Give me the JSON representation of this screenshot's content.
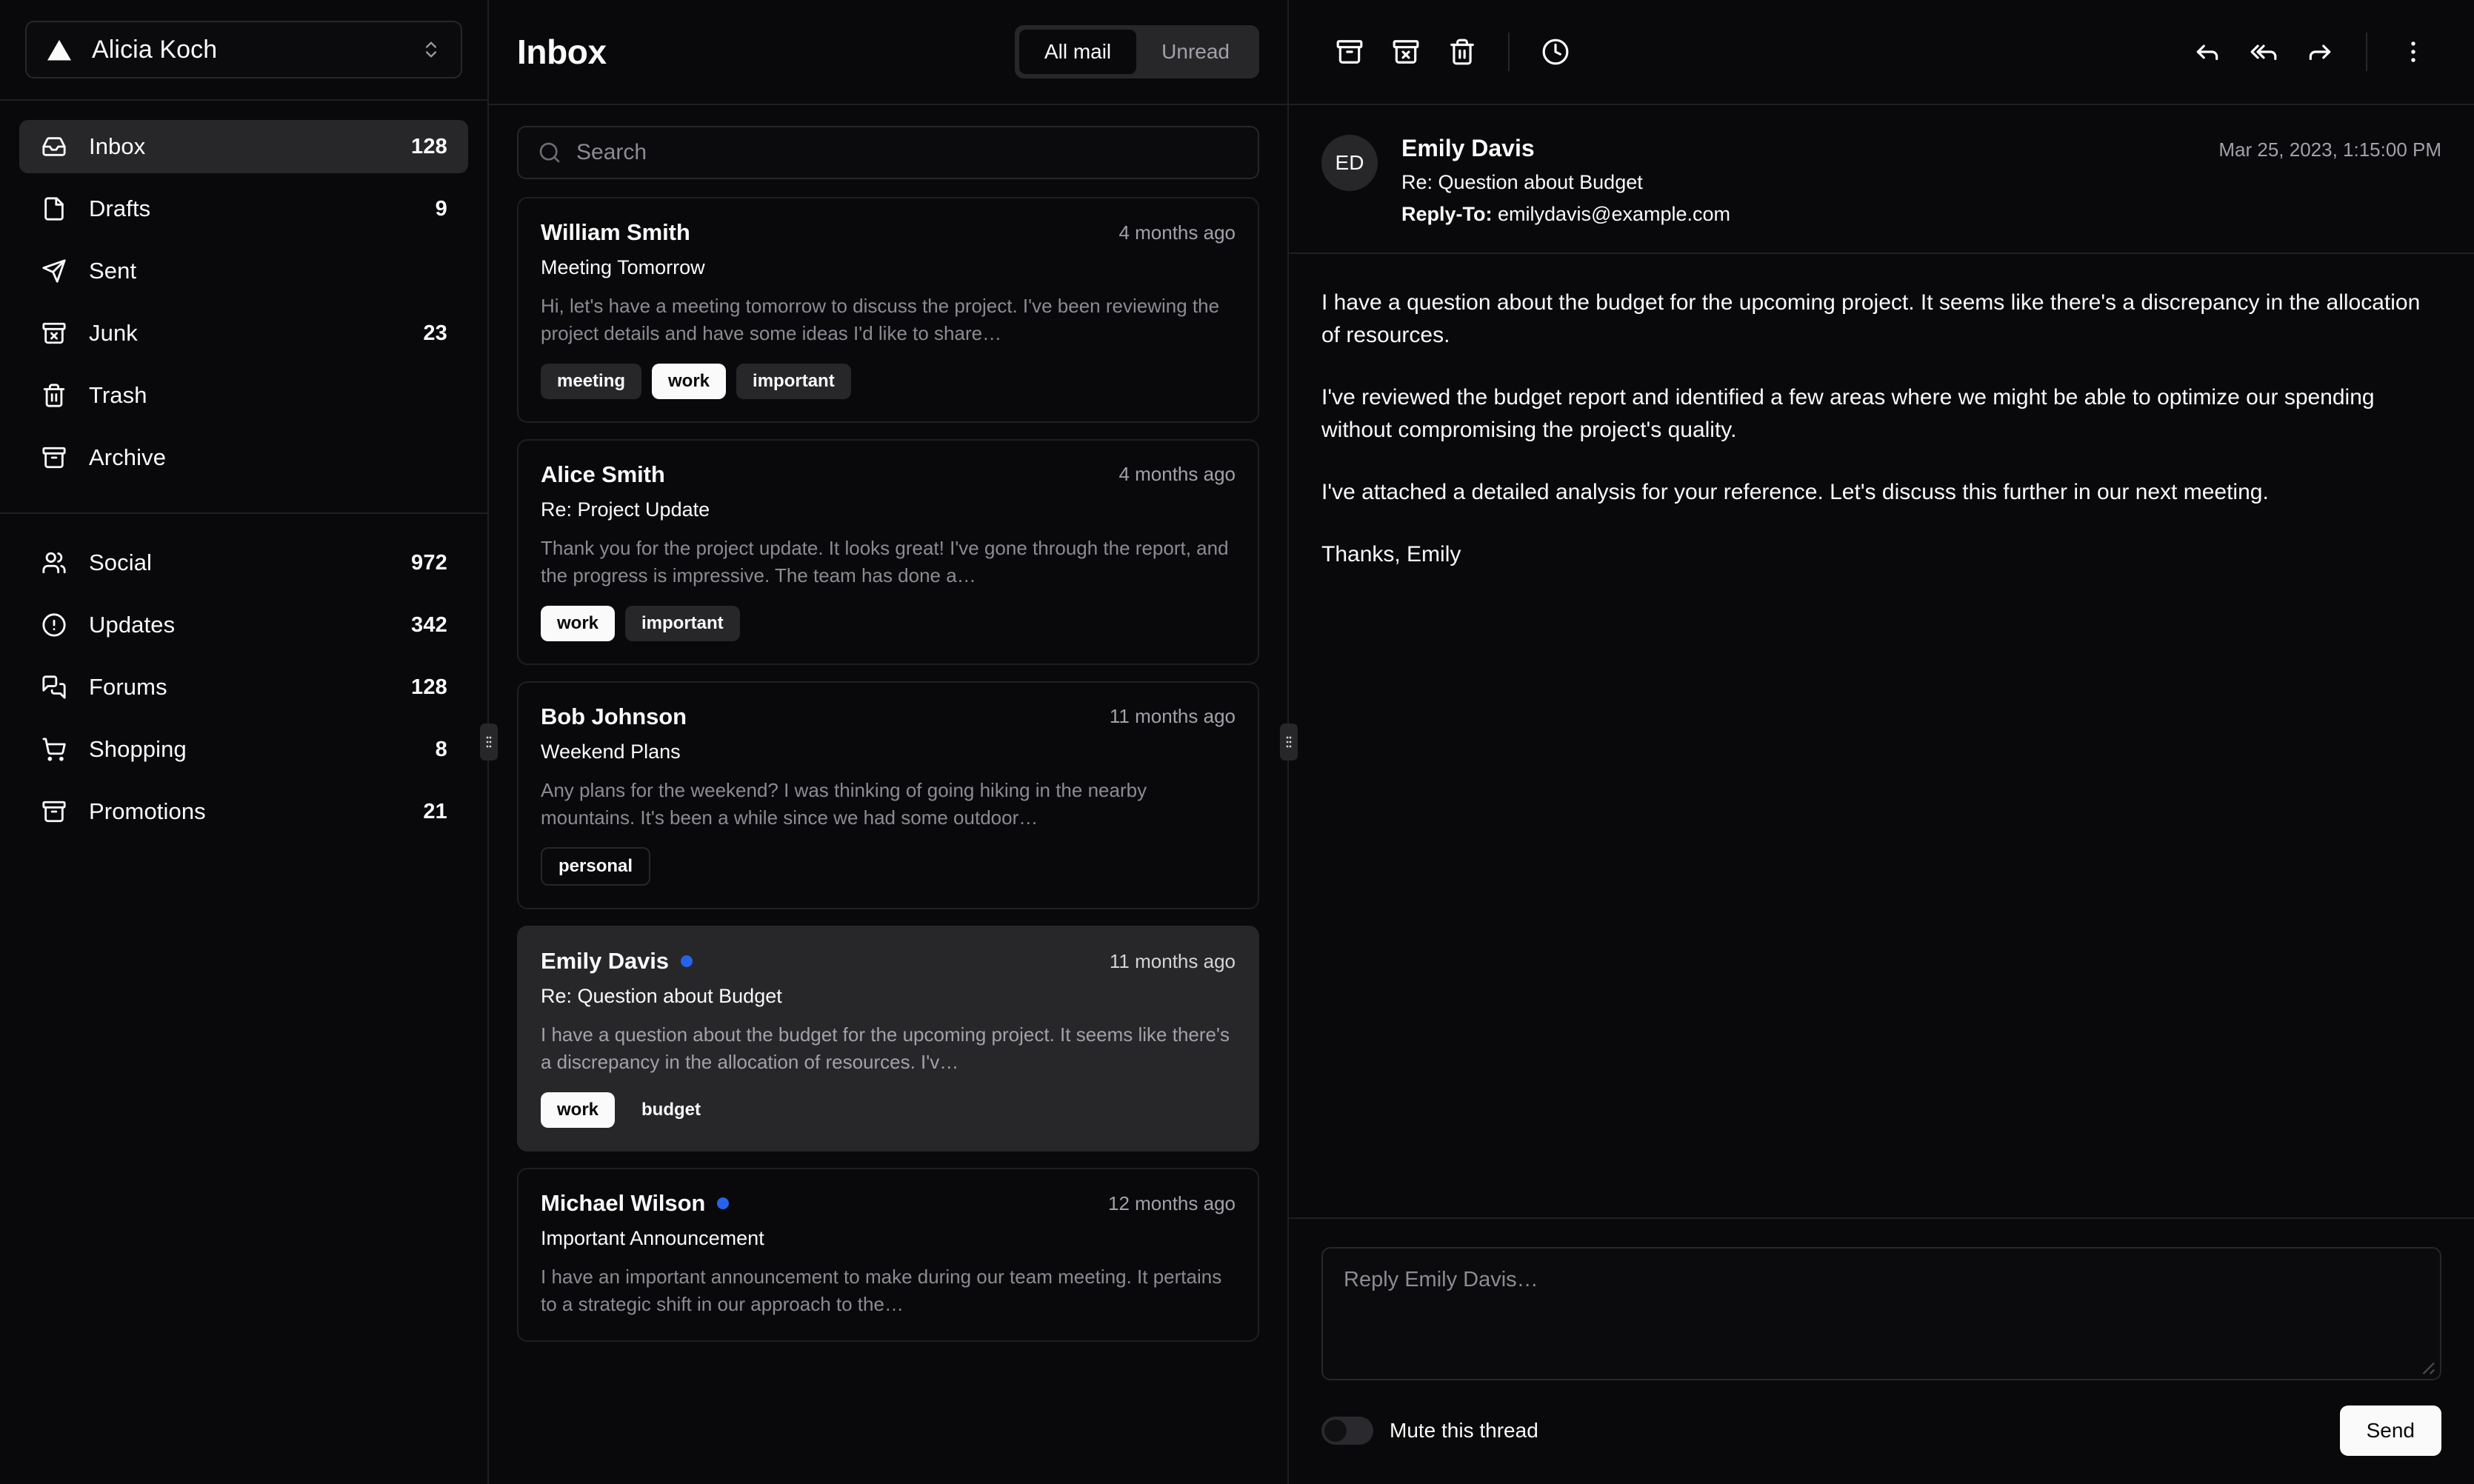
{
  "accent": {
    "unread_dot": "#2563eb",
    "selected_bg": "#27272a",
    "border": "#27272a"
  },
  "sidebar": {
    "account": {
      "name": "Alicia Koch",
      "logo": "triangle-logo",
      "chevron": "chevrons-up-down-icon"
    },
    "groups": [
      {
        "items": [
          {
            "label": "Inbox",
            "count": "128",
            "icon": "inbox-icon",
            "active": true
          },
          {
            "label": "Drafts",
            "count": "9",
            "icon": "file-icon",
            "active": false
          },
          {
            "label": "Sent",
            "count": "",
            "icon": "send-icon",
            "active": false
          },
          {
            "label": "Junk",
            "count": "23",
            "icon": "archive-x-icon",
            "active": false
          },
          {
            "label": "Trash",
            "count": "",
            "icon": "trash-icon",
            "active": false
          },
          {
            "label": "Archive",
            "count": "",
            "icon": "archive-icon",
            "active": false
          }
        ]
      },
      {
        "items": [
          {
            "label": "Social",
            "count": "972",
            "icon": "users-icon",
            "active": false
          },
          {
            "label": "Updates",
            "count": "342",
            "icon": "alert-circle-icon",
            "active": false
          },
          {
            "label": "Forums",
            "count": "128",
            "icon": "message-square-icon",
            "active": false
          },
          {
            "label": "Shopping",
            "count": "8",
            "icon": "shopping-cart-icon",
            "active": false
          },
          {
            "label": "Promotions",
            "count": "21",
            "icon": "archive-icon",
            "active": false
          }
        ]
      }
    ]
  },
  "list": {
    "title": "Inbox",
    "tabs": [
      {
        "label": "All mail",
        "selected": true
      },
      {
        "label": "Unread",
        "selected": false
      }
    ],
    "search": {
      "placeholder": "Search",
      "value": "",
      "icon": "search-icon"
    },
    "emails": [
      {
        "name": "William Smith",
        "time": "4 months ago",
        "subject": "Meeting Tomorrow",
        "preview": "Hi, let's have a meeting tomorrow to discuss the project. I've been reviewing the project details and have some ideas I'd like to share…",
        "unread": false,
        "selected": false,
        "tags": [
          {
            "label": "meeting",
            "style": "muted"
          },
          {
            "label": "work",
            "style": "solid"
          },
          {
            "label": "important",
            "style": "muted"
          }
        ]
      },
      {
        "name": "Alice Smith",
        "time": "4 months ago",
        "subject": "Re: Project Update",
        "preview": "Thank you for the project update. It looks great! I've gone through the report, and the progress is impressive. The team has done a…",
        "unread": false,
        "selected": false,
        "tags": [
          {
            "label": "work",
            "style": "solid"
          },
          {
            "label": "important",
            "style": "muted"
          }
        ]
      },
      {
        "name": "Bob Johnson",
        "time": "11 months ago",
        "subject": "Weekend Plans",
        "preview": "Any plans for the weekend? I was thinking of going hiking in the nearby mountains. It's been a while since we had some outdoor…",
        "unread": false,
        "selected": false,
        "tags": [
          {
            "label": "personal",
            "style": "outline"
          }
        ]
      },
      {
        "name": "Emily Davis",
        "time": "11 months ago",
        "subject": "Re: Question about Budget",
        "preview": "I have a question about the budget for the upcoming project. It seems like there's a discrepancy in the allocation of resources. I'v…",
        "unread": true,
        "selected": true,
        "tags": [
          {
            "label": "work",
            "style": "solid"
          },
          {
            "label": "budget",
            "style": "ghost"
          }
        ]
      },
      {
        "name": "Michael Wilson",
        "time": "12 months ago",
        "subject": "Important Announcement",
        "preview": "I have an important announcement to make during our team meeting. It pertains to a strategic shift in our approach to the…",
        "unread": true,
        "selected": false,
        "tags": []
      }
    ]
  },
  "reader": {
    "toolbar_left": [
      {
        "name": "archive-icon",
        "label": "Archive"
      },
      {
        "name": "archive-x-icon",
        "label": "Move to junk"
      },
      {
        "name": "trash-icon",
        "label": "Move to trash"
      },
      {
        "name": "clock-icon",
        "label": "Snooze"
      }
    ],
    "toolbar_right": [
      {
        "name": "reply-icon",
        "label": "Reply"
      },
      {
        "name": "reply-all-icon",
        "label": "Reply all"
      },
      {
        "name": "forward-icon",
        "label": "Forward"
      },
      {
        "name": "more-vertical-icon",
        "label": "More"
      }
    ],
    "avatar_initials": "ED",
    "from": "Emily Davis",
    "subject": "Re: Question about Budget",
    "reply_to_label": "Reply-To:",
    "reply_to": "emilydavis@example.com",
    "date": "Mar 25, 2023, 1:15:00 PM",
    "body": [
      "I have a question about the budget for the upcoming project. It seems like there's a discrepancy in the allocation of resources.",
      "I've reviewed the budget report and identified a few areas where we might be able to optimize our spending without compromising the project's quality.",
      "I've attached a detailed analysis for your reference. Let's discuss this further in our next meeting.",
      "Thanks, Emily"
    ],
    "compose": {
      "placeholder": "Reply Emily Davis…",
      "value": "",
      "mute_label": "Mute this thread",
      "mute_on": false,
      "send_label": "Send"
    }
  }
}
